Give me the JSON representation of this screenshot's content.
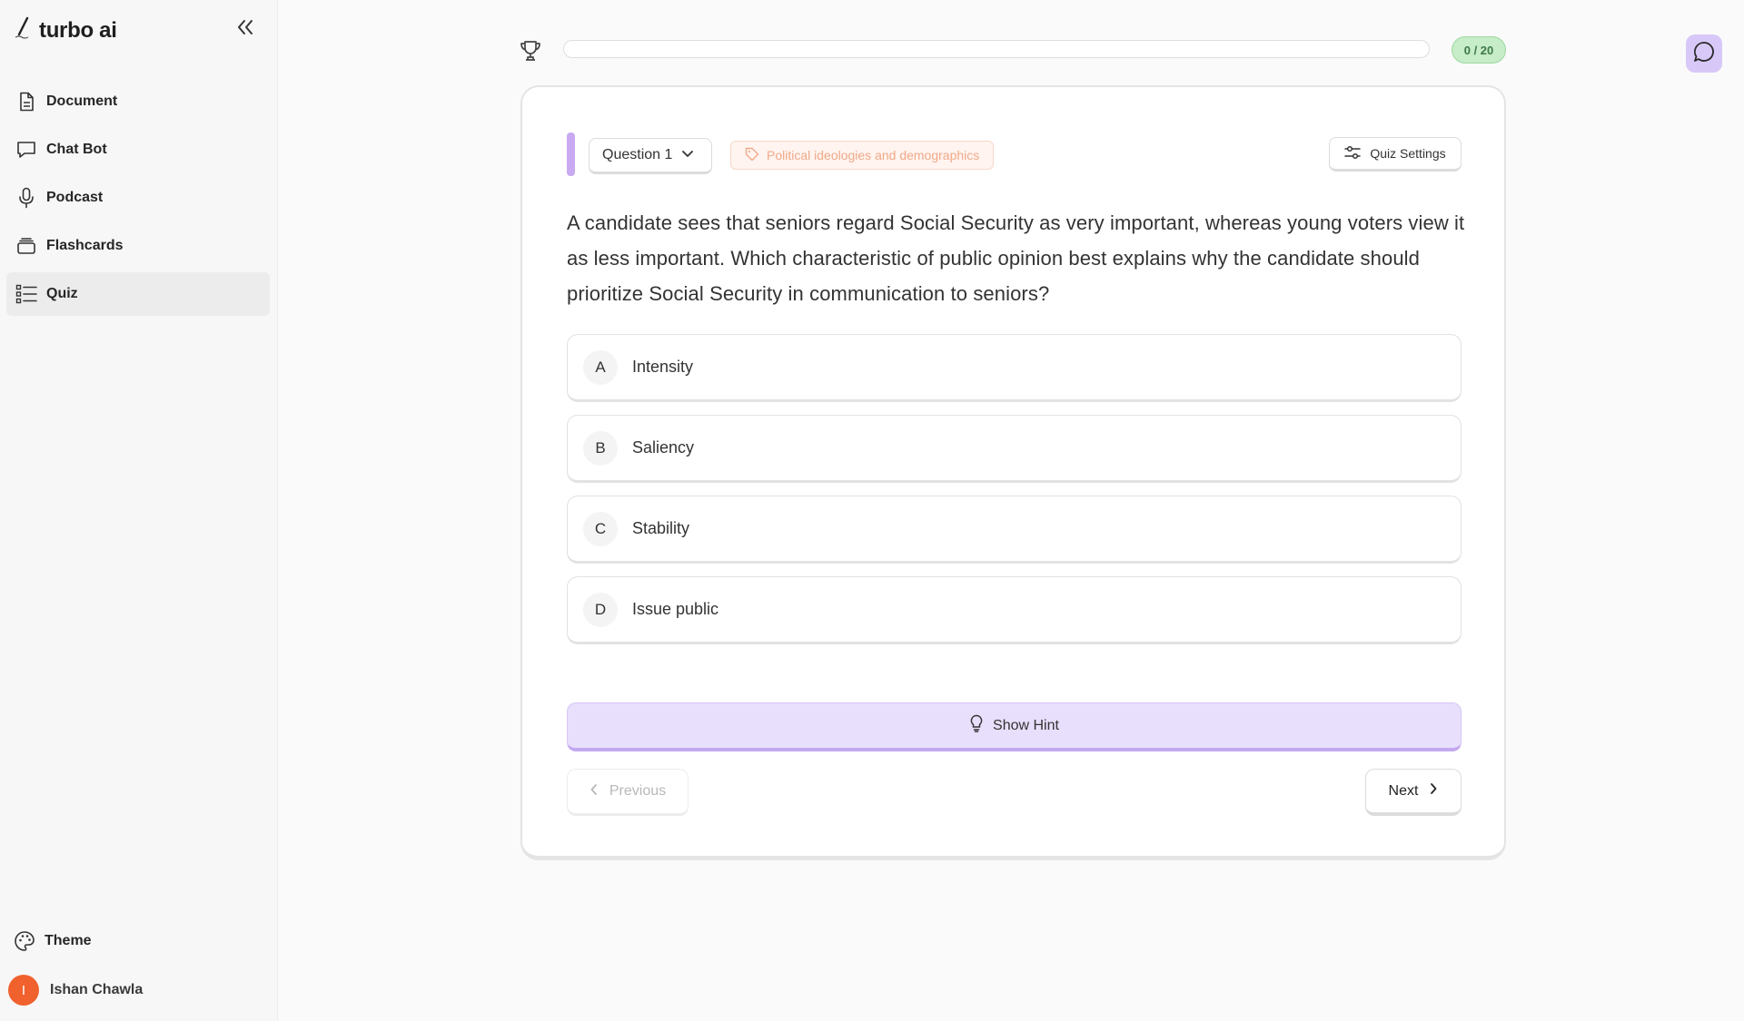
{
  "brand": {
    "name": "turbo ai"
  },
  "sidebar": {
    "items": [
      {
        "label": "Document",
        "icon": "document-icon"
      },
      {
        "label": "Chat Bot",
        "icon": "chat-bubble-icon"
      },
      {
        "label": "Podcast",
        "icon": "microphone-icon"
      },
      {
        "label": "Flashcards",
        "icon": "flashcards-icon"
      },
      {
        "label": "Quiz",
        "icon": "list-icon",
        "active": true
      }
    ],
    "theme_label": "Theme",
    "user": {
      "name": "Ishan Chawla",
      "initial": "I"
    }
  },
  "progress": {
    "score": "0 / 20",
    "fraction": 0
  },
  "quiz": {
    "question_selector": "Question 1",
    "topic_tag": "Political ideologies and demographics",
    "settings_label": "Quiz Settings",
    "question_text": "A candidate sees that seniors regard Social Security as very important, whereas young voters view it as less important. Which characteristic of public opinion best explains why the candidate should prioritize Social Security in communication to seniors?",
    "options": [
      {
        "letter": "A",
        "text": "Intensity"
      },
      {
        "letter": "B",
        "text": "Saliency"
      },
      {
        "letter": "C",
        "text": "Stability"
      },
      {
        "letter": "D",
        "text": "Issue public"
      }
    ],
    "hint_label": "Show Hint",
    "previous_label": "Previous",
    "next_label": "Next"
  },
  "colors": {
    "accent_purple": "#c9a9f2",
    "hint_bg": "#e8dffc",
    "score_green": "#c6ecc8",
    "tag_orange": "#f0a98a",
    "avatar_orange": "#f0612d"
  }
}
